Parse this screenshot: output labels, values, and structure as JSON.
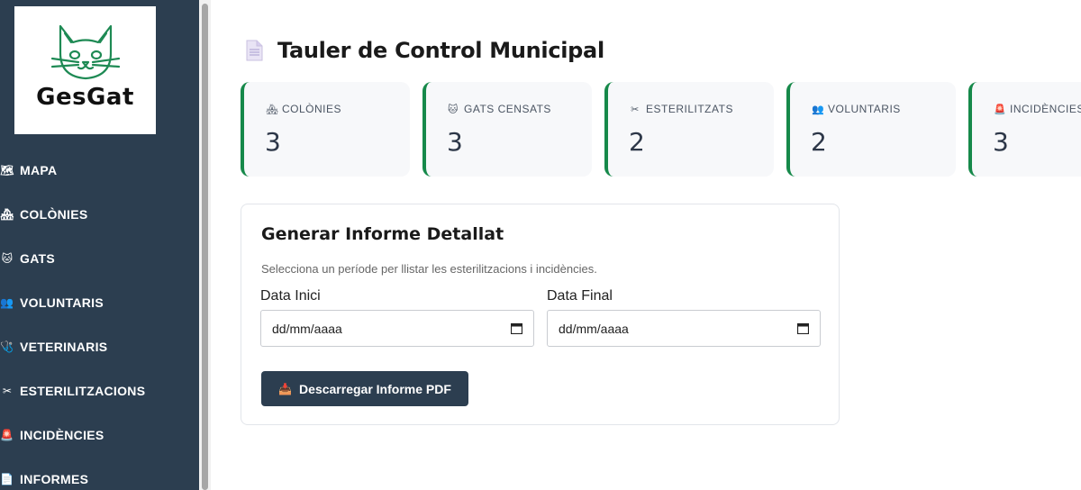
{
  "logo": {
    "text": "GesGat",
    "color": "#1e8a54"
  },
  "sidebar": {
    "items": [
      {
        "icon": "map-icon",
        "glyph": "🗺",
        "label": "MAPA"
      },
      {
        "icon": "house-icon",
        "glyph": "🏘",
        "label": "COLÒNIES"
      },
      {
        "icon": "cat-face-icon",
        "glyph": "🐱",
        "label": "GATS"
      },
      {
        "icon": "people-icon",
        "glyph": "👥",
        "label": "VOLUNTARIS"
      },
      {
        "icon": "stethoscope-icon",
        "glyph": "🩺",
        "label": "VETERINARIS"
      },
      {
        "icon": "scissors-icon",
        "glyph": "✂",
        "label": "ESTERILITZACIONS"
      },
      {
        "icon": "siren-icon",
        "glyph": "🚨",
        "label": "INCIDÈNCIES"
      },
      {
        "icon": "document-icon",
        "glyph": "📄",
        "label": "INFORMES"
      }
    ]
  },
  "header": {
    "title": "Tauler de Control Municipal",
    "icon": "document-icon"
  },
  "stats": [
    {
      "icon": "house-icon",
      "glyph": "🏘",
      "label": "COLÒNIES",
      "value": "3"
    },
    {
      "icon": "cat-face-icon",
      "glyph": "🐱",
      "label": "GATS CENSATS",
      "value": "3"
    },
    {
      "icon": "scissors-icon",
      "glyph": "✂",
      "label": "ESTERILITZATS",
      "value": "2"
    },
    {
      "icon": "people-icon",
      "glyph": "👥",
      "label": "VOLUNTARIS",
      "value": "2"
    },
    {
      "icon": "siren-icon",
      "glyph": "🚨",
      "label": "INCIDÈNCIES",
      "value": "3"
    }
  ],
  "report": {
    "title": "Generar Informe Detallat",
    "description": "Selecciona un període per llistar les esterilitzacions i incidències.",
    "start_label": "Data Inici",
    "start_value": "dd/mm/aaaa",
    "end_label": "Data Final",
    "end_value": "dd/mm/aaaa",
    "button_label": "Descarregar Informe PDF",
    "button_icon": "inbox-tray-icon"
  },
  "colors": {
    "sidebar_bg": "#2c3e50",
    "card_accent": "#16894a",
    "button_bg": "#2c3e50"
  }
}
